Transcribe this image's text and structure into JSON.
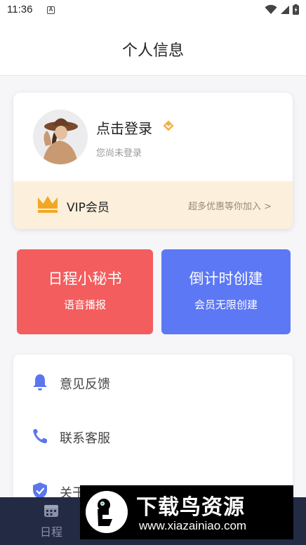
{
  "status_bar": {
    "time": "11:36",
    "notification_glyph": "A"
  },
  "header": {
    "title": "个人信息"
  },
  "profile": {
    "login_title": "点击登录",
    "login_subtitle": "您尚未登录",
    "vip": {
      "label": "VIP会员",
      "promo": "超多优惠等你加入 >"
    }
  },
  "features": [
    {
      "title": "日程小秘书",
      "subtitle": "语音播报"
    },
    {
      "title": "倒计时创建",
      "subtitle": "会员无限创建"
    }
  ],
  "menu": {
    "items": [
      {
        "label": "意见反馈",
        "icon": "bell-icon"
      },
      {
        "label": "联系客服",
        "icon": "phone-icon"
      },
      {
        "label": "关于我们",
        "icon": "shield-icon"
      }
    ]
  },
  "tab_bar": {
    "items": [
      {
        "label": "日程",
        "icon": "calendar-icon"
      }
    ]
  },
  "watermark": {
    "title": "下载鸟资源",
    "url": "www.xiazainiao.com"
  },
  "colors": {
    "accent_red": "#f45d5e",
    "accent_blue": "#5c78f5",
    "icon_blue": "#5b76ee",
    "vip_gold": "#f3a723",
    "vip_background": "#fcf0dc",
    "tab_bar_background": "#232a44"
  }
}
